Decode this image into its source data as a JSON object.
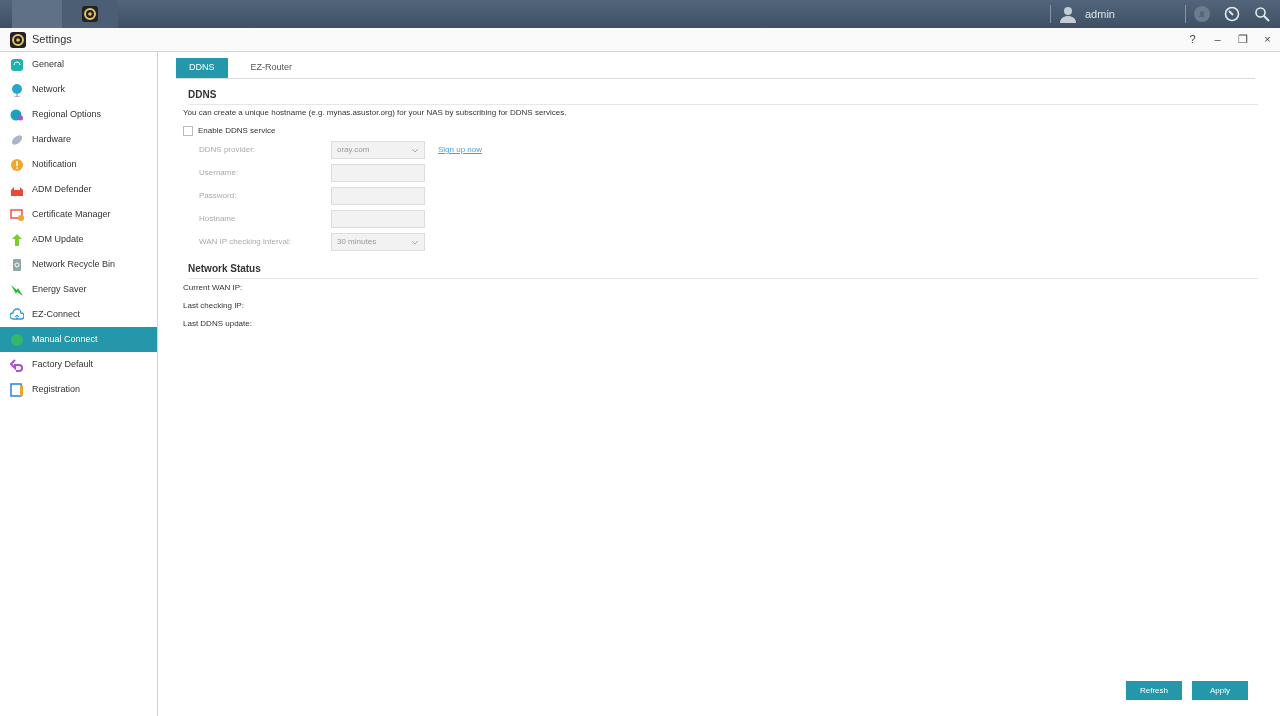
{
  "taskbar": {
    "user": "admin"
  },
  "window": {
    "title": "Settings",
    "controls": [
      "?",
      "–",
      "❐",
      "×"
    ]
  },
  "sidebar": {
    "items": [
      {
        "label": "General",
        "selected": false
      },
      {
        "label": "Network",
        "selected": false
      },
      {
        "label": "Regional Options",
        "selected": false
      },
      {
        "label": "Hardware",
        "selected": false
      },
      {
        "label": "Notification",
        "selected": false
      },
      {
        "label": "ADM Defender",
        "selected": false
      },
      {
        "label": "Certificate Manager",
        "selected": false
      },
      {
        "label": "ADM Update",
        "selected": false
      },
      {
        "label": "Network Recycle Bin",
        "selected": false
      },
      {
        "label": "Energy Saver",
        "selected": false
      },
      {
        "label": "EZ-Connect",
        "selected": false
      },
      {
        "label": "Manual Connect",
        "selected": true
      },
      {
        "label": "Factory Default",
        "selected": false
      },
      {
        "label": "Registration",
        "selected": false
      }
    ]
  },
  "tabs": [
    {
      "label": "DDNS",
      "selected": true
    },
    {
      "label": "EZ-Router",
      "selected": false
    }
  ],
  "ddns": {
    "heading": "DDNS",
    "description": "You can create a unique hostname (e.g. mynas.asustor.org) for your NAS by subscribing for DDNS services.",
    "enable": {
      "label": "Enable DDNS service",
      "checked": false
    },
    "fields": [
      {
        "kind": "select",
        "label": "DDNS provider:",
        "value": "oray.com",
        "disabled": true,
        "link": "Sign up now"
      },
      {
        "kind": "text",
        "label": "Username:",
        "disabled": true
      },
      {
        "kind": "text",
        "label": "Password:",
        "disabled": true
      },
      {
        "kind": "text",
        "label": "Hostname",
        "disabled": true
      },
      {
        "kind": "select",
        "label": "WAN IP checking interval:",
        "value": "30 minutes",
        "disabled": true
      }
    ]
  },
  "network_status": {
    "heading": "Network Status",
    "rows": [
      "Current WAN IP:",
      "Last checking IP:",
      "Last DDNS update:"
    ]
  },
  "buttons": [
    "Refresh",
    "Apply"
  ]
}
